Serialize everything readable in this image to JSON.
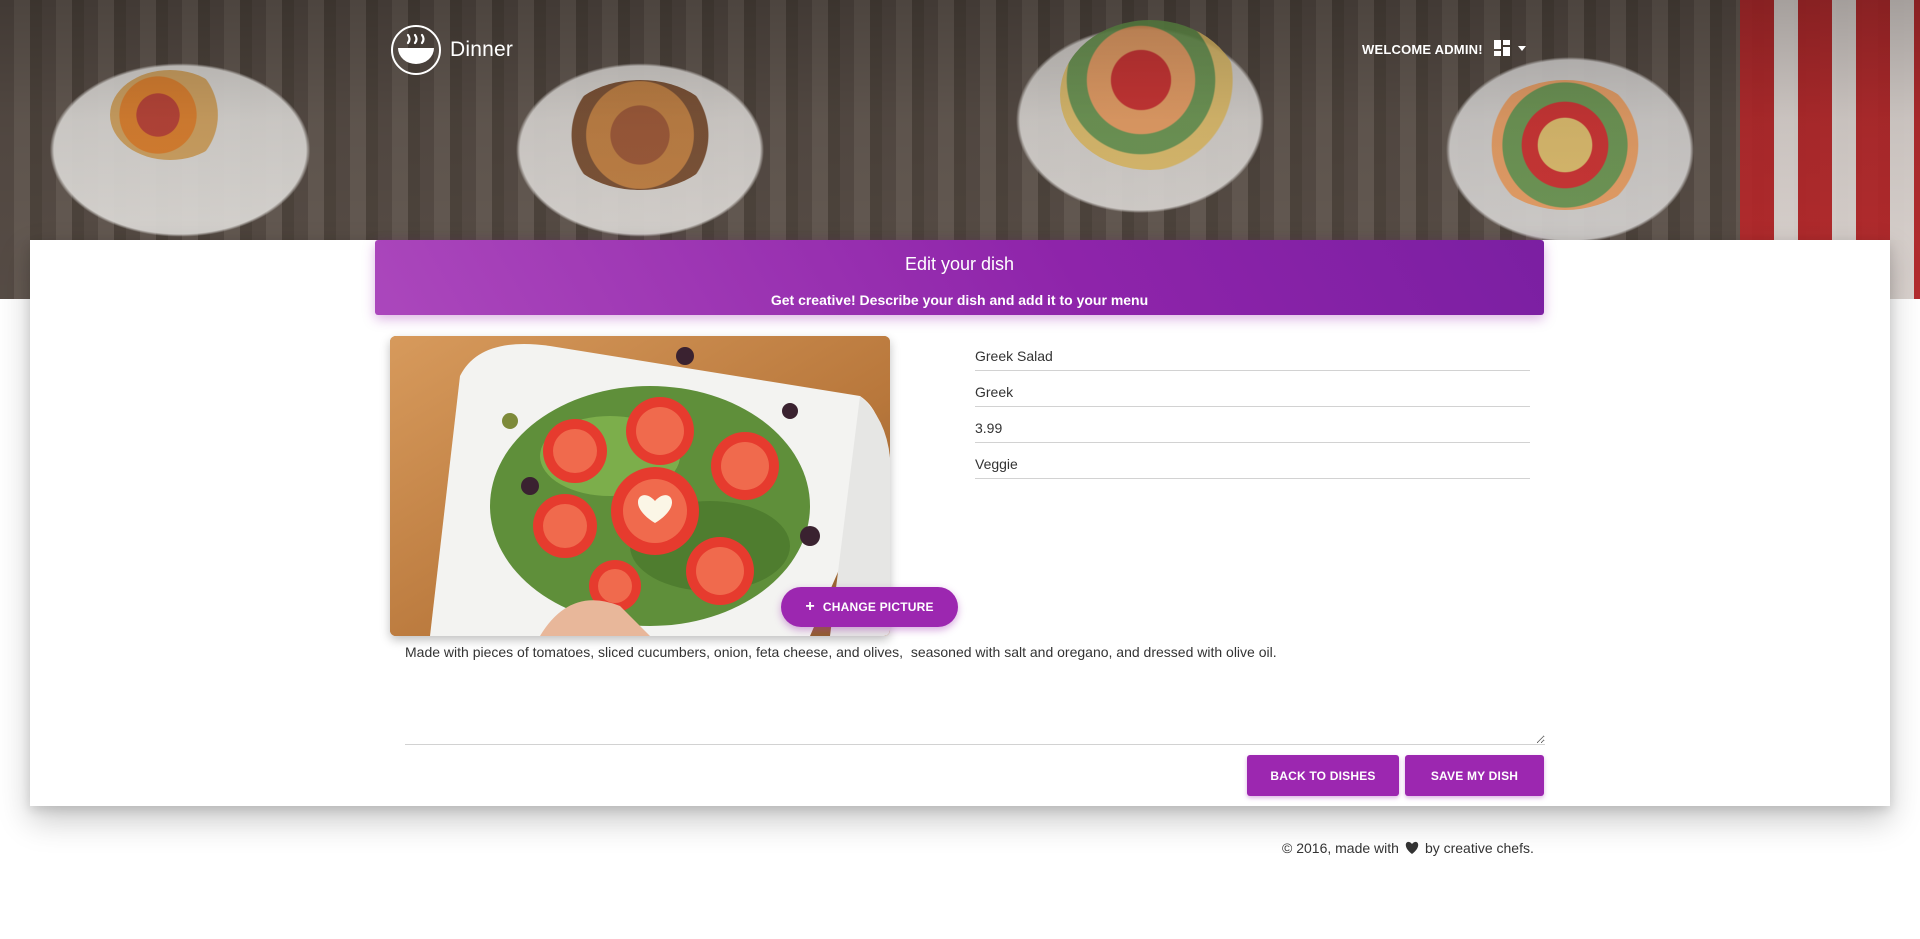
{
  "header": {
    "brand_name": "Dinner",
    "welcome_text": "WELCOME ADMIN!",
    "menu_icon": "dashboard-icon"
  },
  "card": {
    "title": "Edit your dish",
    "subtitle": "Get creative! Describe your dish and add it to your menu"
  },
  "form": {
    "name": "Greek Salad",
    "cuisine": "Greek",
    "price": "3.99",
    "category": "Veggie",
    "description": "Made with pieces of tomatoes, sliced cucumbers, onion, feta cheese, and olives,  seasoned with salt and oregano, and dressed with olive oil.",
    "change_picture_label": "CHANGE PICTURE"
  },
  "actions": {
    "back_label": "BACK TO DISHES",
    "save_label": "SAVE MY DISH"
  },
  "footer": {
    "prefix": "© 2016, made with",
    "suffix": "by creative chefs."
  },
  "colors": {
    "accent": "#9c27b0",
    "accent_light": "#ab47bc"
  }
}
